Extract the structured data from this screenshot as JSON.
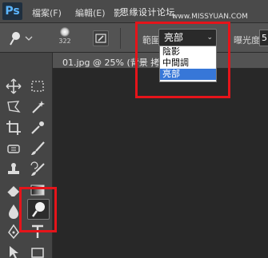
{
  "app": {
    "logo": "Ps"
  },
  "menu": {
    "items": [
      {
        "label": "檔案(F)"
      },
      {
        "label": "編輯(E)"
      },
      {
        "label": "影"
      }
    ],
    "watermark": "思缘设计论坛",
    "watermark_site": "www.MISSYUAN.COM"
  },
  "options": {
    "brush_size": "322",
    "range_label": "範圍:",
    "range_value": "亮部",
    "exposure_label": "曝光度:",
    "exposure_value": "5"
  },
  "dropdown": {
    "options": [
      {
        "label": "陰影"
      },
      {
        "label": "中間調"
      },
      {
        "label": "亮部"
      }
    ],
    "selected": "亮部"
  },
  "document": {
    "tab_title": "01.jpg @ 25% (背景 拷"
  },
  "toolbar": {
    "selected_tool": "dodge"
  },
  "colors": {
    "highlight": "#e5141a",
    "selection": "#3777d8"
  }
}
